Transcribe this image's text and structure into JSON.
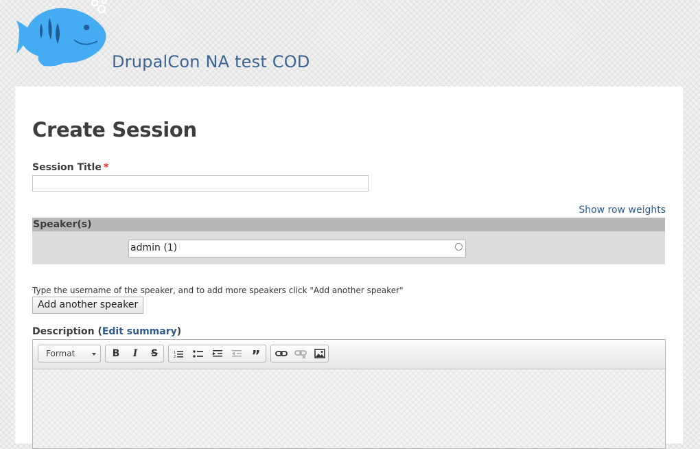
{
  "site": {
    "name": "DrupalCon NA test COD"
  },
  "page": {
    "title": "Create Session"
  },
  "form": {
    "session_title_label": "Session Title",
    "required_marker": "*",
    "session_title_value": "",
    "show_row_weights": "Show row weights",
    "speakers_header": "Speaker(s)",
    "speaker_value": "admin (1)",
    "speakers_help": "Type the username of the speaker, and to add more speakers click \"Add another speaker\"",
    "add_speaker_button": "Add another speaker",
    "description_label": "Description",
    "description_paren_open": "(",
    "edit_summary": "Edit summary",
    "description_paren_close": ")"
  },
  "editor": {
    "format_label": "Format",
    "buttons": {
      "bold": "B",
      "italic": "I",
      "strike": "S",
      "blockquote": "”"
    }
  },
  "colors": {
    "link": "#2f5b8c",
    "required": "#e0231e",
    "fish": "#3fa9f5"
  }
}
